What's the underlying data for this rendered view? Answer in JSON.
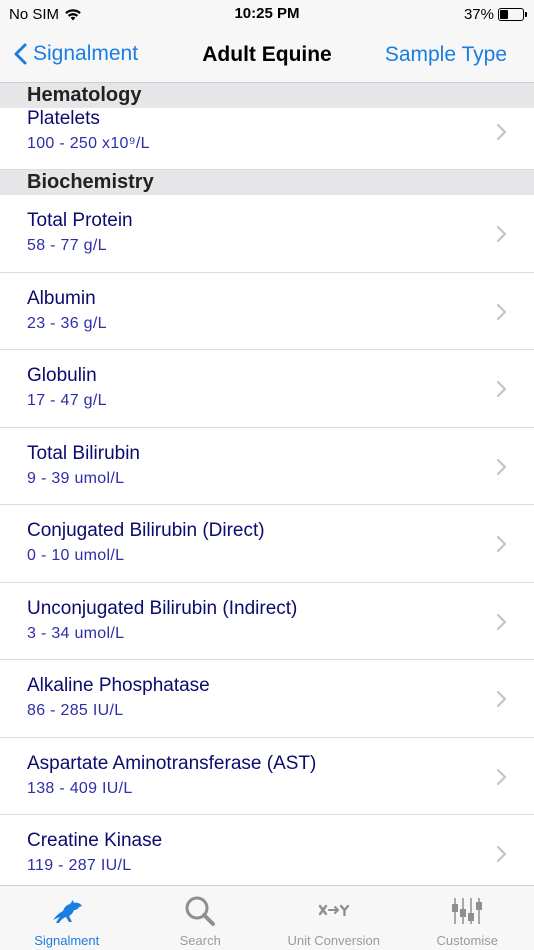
{
  "status_bar": {
    "carrier": "No SIM",
    "time": "10:25 PM",
    "battery_percent": "37%",
    "battery_level": 0.37
  },
  "nav": {
    "back_label": "Signalment",
    "title": "Adult Equine",
    "right_label": "Sample Type"
  },
  "sections": [
    {
      "header": "Hematology",
      "items": [
        {
          "name": "Platelets",
          "range": "100 - 250 x10⁹/L"
        }
      ]
    },
    {
      "header": "Biochemistry",
      "items": [
        {
          "name": "Total Protein",
          "range": "58 - 77 g/L"
        },
        {
          "name": "Albumin",
          "range": "23 - 36 g/L"
        },
        {
          "name": "Globulin",
          "range": "17 - 47 g/L"
        },
        {
          "name": "Total Bilirubin",
          "range": "9 - 39 umol/L"
        },
        {
          "name": "Conjugated Bilirubin (Direct)",
          "range": "0 - 10 umol/L"
        },
        {
          "name": "Unconjugated Bilirubin (Indirect)",
          "range": "3 - 34 umol/L"
        },
        {
          "name": "Alkaline Phosphatase",
          "range": "86 - 285 IU/L"
        },
        {
          "name": "Aspartate Aminotransferase (AST)",
          "range": "138 - 409 IU/L"
        },
        {
          "name": "Creatine Kinase",
          "range": "119 - 287 IU/L"
        }
      ]
    }
  ],
  "tabs": [
    {
      "label": "Signalment",
      "icon": "horse-icon",
      "active": true
    },
    {
      "label": "Search",
      "icon": "search-icon",
      "active": false
    },
    {
      "label": "Unit Conversion",
      "icon": "unit-conversion-icon",
      "active": false
    },
    {
      "label": "Customise",
      "icon": "sliders-icon",
      "active": false
    }
  ],
  "colors": {
    "accent": "#1a7de0",
    "row_title": "#0b0b6e",
    "row_sub": "#2e2eaa",
    "section_bg": "#e6e6e8"
  }
}
